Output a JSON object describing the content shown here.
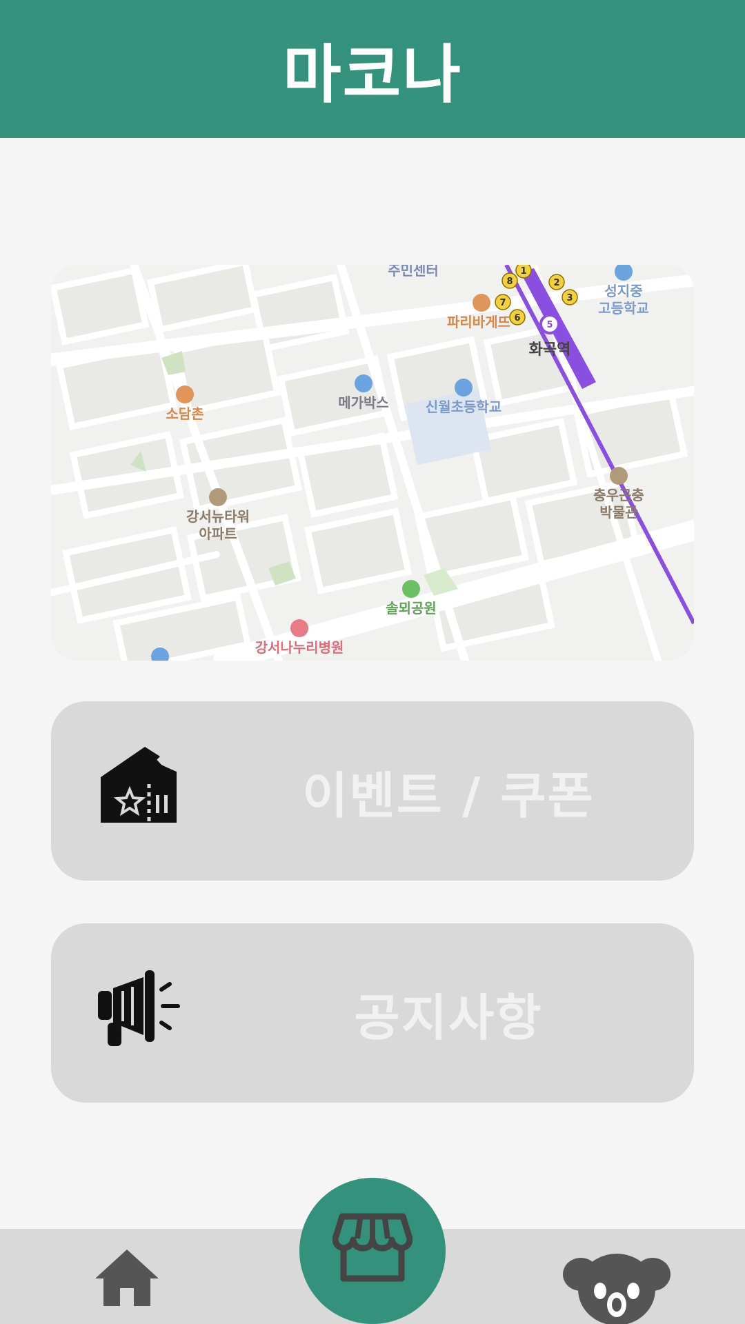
{
  "header": {
    "title": "마코나"
  },
  "map": {
    "labels": {
      "community_center": "주민센터",
      "paris_baguette": "파리바게뜨",
      "hwagok_station": "화곡역",
      "seongji_school_1": "성지중",
      "seongji_school_2": "고등학교",
      "megabox": "메가박스",
      "sinwol_school": "신월초등학교",
      "sodamchon": "소담촌",
      "gangseo_tower_1": "강서뉴타워",
      "gangseo_tower_2": "아파트",
      "museum_1": "충우곤충",
      "museum_2": "박물관",
      "park": "솔뫼공원",
      "hospital": "강서나누리병원"
    },
    "exits": [
      "1",
      "2",
      "3",
      "5",
      "6",
      "7",
      "8"
    ],
    "colors": {
      "subway_line": "#8a4fe0",
      "exit_badge": "#f2d23c"
    }
  },
  "menu": {
    "events": {
      "label": "이벤트 / 쿠폰",
      "icon": "coupon-ticket-icon"
    },
    "notice": {
      "label": "공지사항",
      "icon": "megaphone-icon"
    }
  },
  "nav": {
    "home": {
      "icon": "home-icon"
    },
    "store": {
      "icon": "store-icon"
    },
    "profile": {
      "icon": "koala-icon"
    }
  },
  "colors": {
    "accent": "#33917c",
    "card": "#d9d9d9",
    "background": "#f5f5f5"
  }
}
